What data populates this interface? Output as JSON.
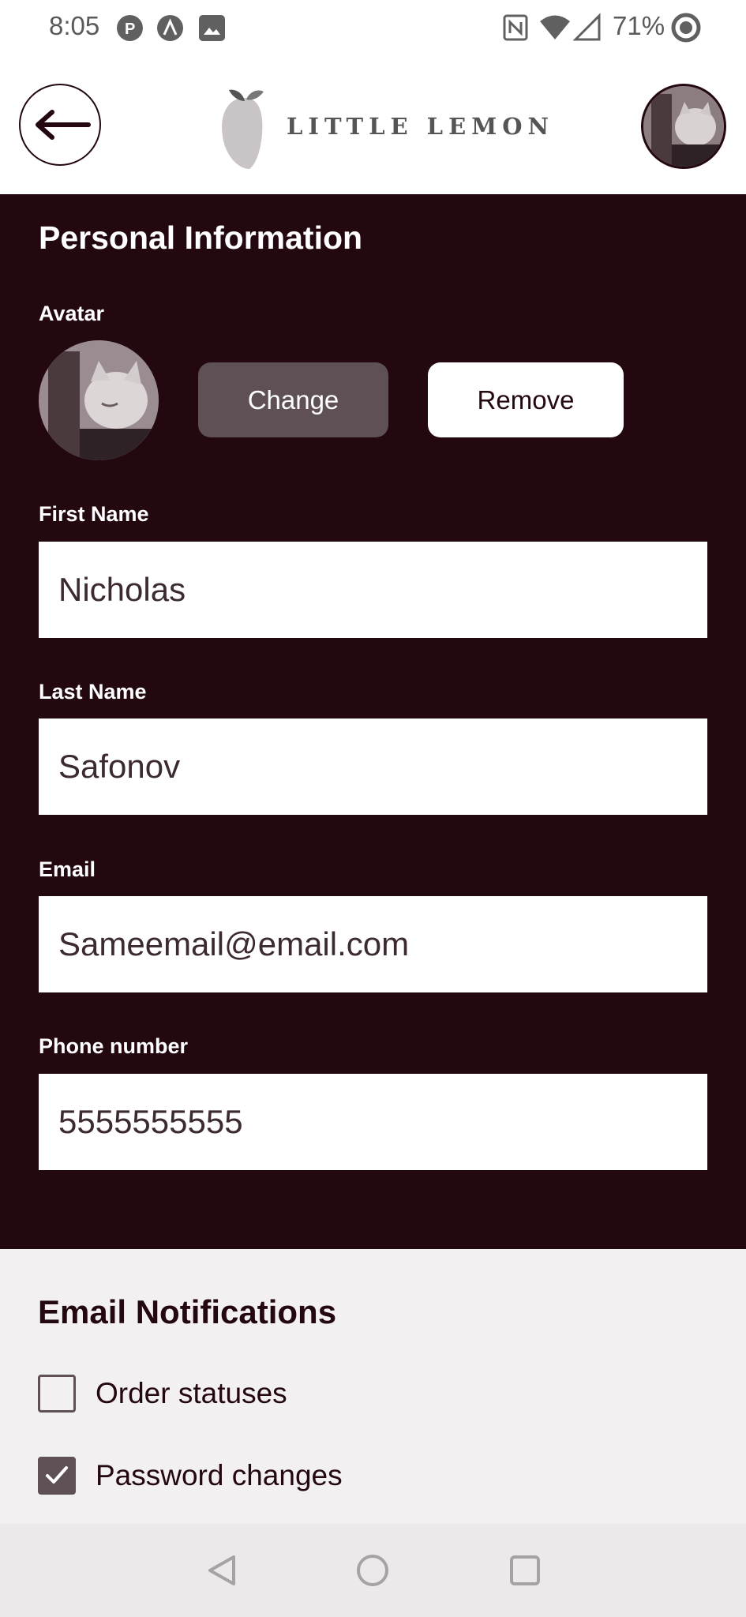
{
  "status_bar": {
    "time": "8:05",
    "battery": "71%",
    "icons": [
      "app-p-icon",
      "app-a-icon",
      "image-icon",
      "nfc-icon",
      "wifi-icon",
      "signal-icon",
      "battery-circle-icon"
    ]
  },
  "header": {
    "logo_text": "LITTLE LEMON",
    "back_icon": "arrow-left-icon"
  },
  "personal": {
    "title": "Personal Information",
    "avatar_label": "Avatar",
    "change_label": "Change",
    "remove_label": "Remove",
    "first_name_label": "First Name",
    "first_name_value": "Nicholas",
    "last_name_label": "Last Name",
    "last_name_value": "Safonov",
    "email_label": "Email",
    "email_value": "Sameemail@email.com",
    "phone_label": "Phone number",
    "phone_value": "5555555555"
  },
  "notifications": {
    "title": "Email Notifications",
    "items": [
      {
        "label": "Order statuses",
        "checked": false
      },
      {
        "label": "Password changes",
        "checked": true
      }
    ]
  },
  "colors": {
    "primary_dark": "#23080f",
    "button_muted": "#5f5055",
    "notifications_bg": "#f2f0f1"
  }
}
